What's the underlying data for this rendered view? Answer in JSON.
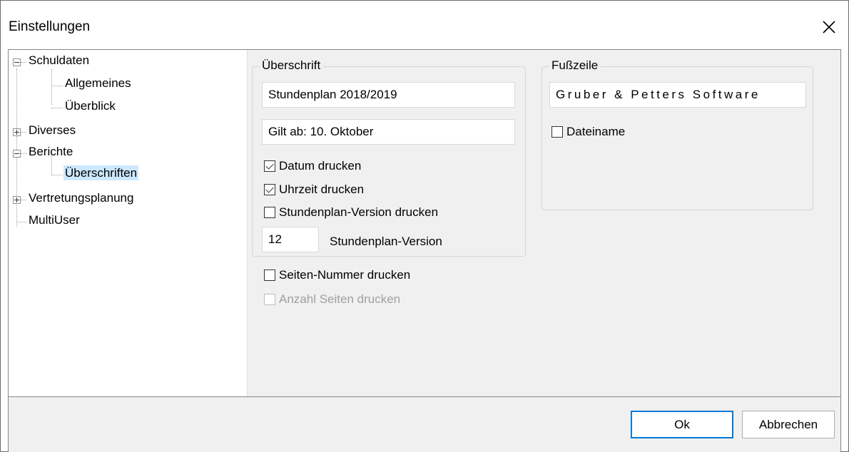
{
  "window": {
    "title": "Einstellungen"
  },
  "tree": {
    "schuldaten": "Schuldaten",
    "allgemeines": "Allgemeines",
    "ueberblick": "Überblick",
    "diverses": "Diverses",
    "berichte": "Berichte",
    "ueberschriften": "Überschriften",
    "vertretungsplanung": "Vertretungsplanung",
    "multiuser": "MultiUser",
    "selected": "Überschriften"
  },
  "header_group": {
    "label": "Überschrift",
    "line1": "Stundenplan 2018/2019",
    "line2": "Gilt ab: 10. Oktober",
    "print_date_label": "Datum drucken",
    "print_date_checked": true,
    "print_time_label": "Uhrzeit drucken",
    "print_time_checked": true,
    "print_version_label": "Stundenplan-Version drucken",
    "print_version_checked": false,
    "version_value": "12",
    "version_label": "Stundenplan-Version"
  },
  "page_options": {
    "page_number_label": "Seiten-Nummer drucken",
    "page_number_checked": false,
    "page_count_label": "Anzahl Seiten drucken",
    "page_count_checked": false,
    "page_count_enabled": false
  },
  "footer_group": {
    "label": "Fußzeile",
    "text": "Gruber & Petters Software",
    "filename_label": "Dateiname",
    "filename_checked": false
  },
  "buttons": {
    "ok": "Ok",
    "cancel": "Abbrechen"
  },
  "colors": {
    "selection": "#cce8ff",
    "default_button_border": "#0078d7",
    "panel_background": "#f0f0f0"
  }
}
